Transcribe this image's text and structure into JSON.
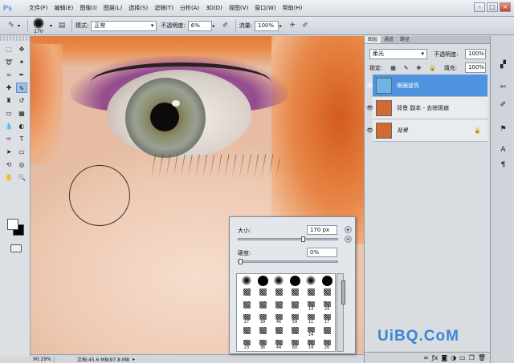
{
  "app": {
    "logo": "Ps"
  },
  "menu": [
    "文件(F)",
    "编辑(E)",
    "图像(I)",
    "图层(L)",
    "选择(S)",
    "滤镜(T)",
    "分析(A)",
    "3D(D)",
    "视图(V)",
    "窗口(W)",
    "帮助(H)"
  ],
  "options": {
    "brush_size": "170",
    "mode_label": "模式:",
    "mode_value": "正常",
    "opacity_label": "不透明度:",
    "opacity_value": "6%",
    "flow_label": "流量:",
    "flow_value": "100%"
  },
  "status": {
    "zoom": "90.29%",
    "doc": "文档:45.6 MB/97.8 MB"
  },
  "brush_panel": {
    "size_label": "大小:",
    "size_value": "170 px",
    "size_fraction": 0.65,
    "hardness_label": "硬度:",
    "hardness_value": "0%",
    "hardness_fraction": 0,
    "presets": [
      {
        "row": 0,
        "items": [
          {
            "n": "",
            "s": "soft"
          },
          {
            "n": "",
            "s": "hard"
          },
          {
            "n": "",
            "s": "soft"
          },
          {
            "n": "",
            "s": "hard"
          },
          {
            "n": "",
            "s": "soft"
          },
          {
            "n": "",
            "s": "hard"
          }
        ]
      },
      {
        "row": 1,
        "items": [
          {
            "n": "",
            "s": "tex"
          },
          {
            "n": "",
            "s": "tex"
          },
          {
            "n": "",
            "s": "tex"
          },
          {
            "n": "",
            "s": "tex"
          },
          {
            "n": "",
            "s": "tex"
          },
          {
            "n": "",
            "s": "tex"
          }
        ]
      },
      {
        "row": 2,
        "items": [
          {
            "n": "",
            "s": "tex"
          },
          {
            "n": "",
            "s": "tex"
          },
          {
            "n": "",
            "s": "tex"
          },
          {
            "n": "",
            "s": "tex"
          },
          {
            "n": "14",
            "s": "tex"
          },
          {
            "n": "24",
            "s": "tex"
          }
        ]
      },
      {
        "row": 3,
        "items": [
          {
            "n": "27",
            "s": "tex"
          },
          {
            "n": "39",
            "s": "tex"
          },
          {
            "n": "46",
            "s": "tex"
          },
          {
            "n": "59",
            "s": "tex"
          },
          {
            "n": "11",
            "s": "tex"
          },
          {
            "n": "17",
            "s": "tex"
          }
        ]
      },
      {
        "row": 4,
        "items": [
          {
            "n": "",
            "s": "tex"
          },
          {
            "n": "",
            "s": "tex"
          },
          {
            "n": "",
            "s": "tex"
          },
          {
            "n": "",
            "s": "tex"
          },
          {
            "n": "14",
            "s": "tex"
          },
          {
            "n": "",
            "s": "tex"
          }
        ]
      },
      {
        "row": 5,
        "items": [
          {
            "n": "23",
            "s": "tex"
          },
          {
            "n": "36",
            "s": "tex"
          },
          {
            "n": "44",
            "s": "tex"
          },
          {
            "n": "60",
            "s": "tex"
          },
          {
            "n": "14",
            "s": "tex"
          },
          {
            "n": "26",
            "s": "tex"
          }
        ]
      }
    ]
  },
  "layers_panel": {
    "tabs": [
      "图层",
      "通道",
      "路径"
    ],
    "blend_mode": "柔光",
    "opacity_label": "不透明度:",
    "opacity_value": "100%",
    "lock_label": "锁定:",
    "fill_label": "填充:",
    "fill_value": "100%",
    "layers": [
      {
        "name": "眼圈提亮",
        "selected": true,
        "thumb": "#6fb4e8"
      },
      {
        "name": "背景 副本 - 去除斑痕",
        "selected": false,
        "thumb": "#d36a33"
      },
      {
        "name": "背景",
        "selected": false,
        "thumb": "#d36a33",
        "locked": true
      }
    ]
  },
  "watermark": "UiBQ.CoM"
}
